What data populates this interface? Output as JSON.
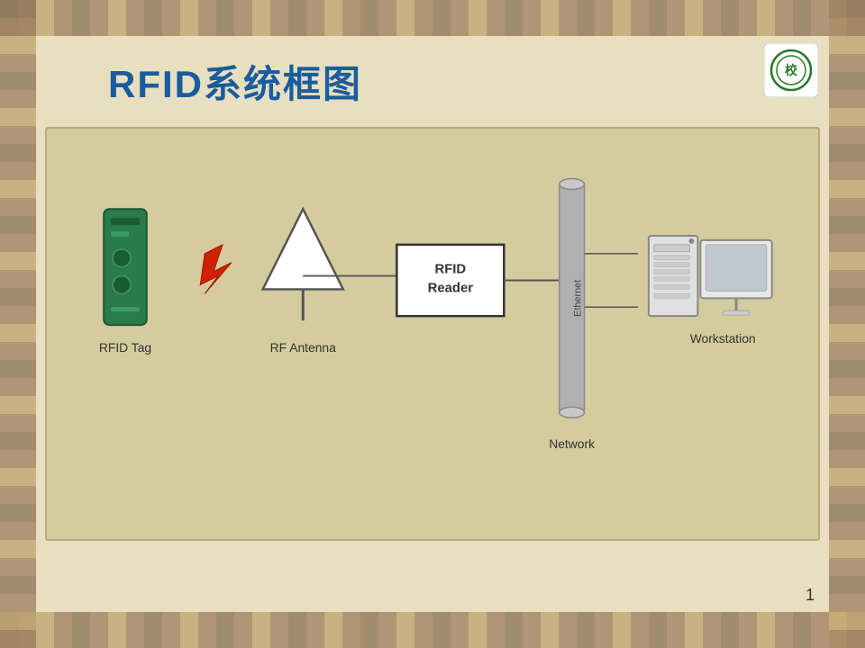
{
  "page": {
    "title": "RFID系统框图",
    "page_number": "1",
    "background_color": "#d4c9a8"
  },
  "diagram": {
    "labels": {
      "rfid_tag": "RFID Tag",
      "rf_antenna": "RF Antenna",
      "rfid_reader_line1": "RFID",
      "rfid_reader_line2": "Reader",
      "network": "Network",
      "workstation": "Workstation",
      "ethernet": "Ethernet"
    }
  },
  "logo": {
    "alt": "Institution logo"
  }
}
